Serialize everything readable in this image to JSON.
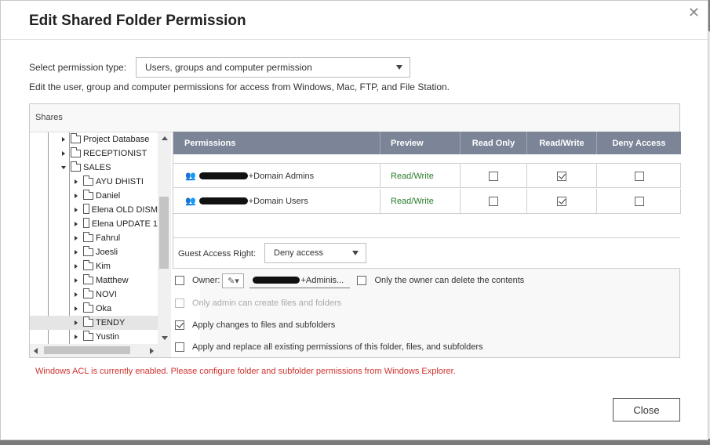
{
  "dialog": {
    "title": "Edit Shared Folder Permission",
    "close_icon": "close-icon"
  },
  "permission_type": {
    "label": "Select permission type:",
    "value": "Users, groups and computer permission"
  },
  "description": "Edit the user, group and computer permissions for access from Windows, Mac, FTP, and File Station.",
  "shares": {
    "label": "Shares",
    "items": [
      {
        "label": "Project Database",
        "expanded": false,
        "selected": false
      },
      {
        "label": "RECEPTIONIST",
        "expanded": false,
        "selected": false
      },
      {
        "label": "SALES",
        "expanded": true,
        "selected": false
      },
      {
        "label": "AYU DHISTI",
        "expanded": false,
        "selected": false
      },
      {
        "label": "Daniel",
        "expanded": false,
        "selected": false
      },
      {
        "label": "Elena OLD DISM",
        "expanded": false,
        "selected": false
      },
      {
        "label": "Elena UPDATE 1",
        "expanded": false,
        "selected": false
      },
      {
        "label": "Fahrul",
        "expanded": false,
        "selected": false
      },
      {
        "label": "Joesli",
        "expanded": false,
        "selected": false
      },
      {
        "label": "Kim",
        "expanded": false,
        "selected": false
      },
      {
        "label": "Matthew",
        "expanded": false,
        "selected": false
      },
      {
        "label": "NOVI",
        "expanded": false,
        "selected": false
      },
      {
        "label": "Oka",
        "expanded": false,
        "selected": false
      },
      {
        "label": "TENDY",
        "expanded": false,
        "selected": true
      },
      {
        "label": "Yustin",
        "expanded": false,
        "selected": false
      }
    ]
  },
  "permissions_table": {
    "columns": [
      "Permissions",
      "Preview",
      "Read Only",
      "Read/Write",
      "Deny Access"
    ],
    "rows": [
      {
        "name": "+Domain Admins",
        "preview": "Read/Write",
        "read_only": false,
        "read_write": true,
        "deny": false
      },
      {
        "name": "+Domain Users",
        "preview": "Read/Write",
        "read_only": false,
        "read_write": true,
        "deny": false
      }
    ]
  },
  "guest_access": {
    "label": "Guest Access Right:",
    "value": "Deny access"
  },
  "options": {
    "owner_label": "Owner:",
    "owner_value": "+Adminis...",
    "owner_only_delete": "Only the owner can delete the contents",
    "admin_only_create": "Only admin can create files and folders",
    "apply_changes": "Apply changes to files and subfolders",
    "apply_replace": "Apply and replace all existing permissions of this folder, files, and subfolders"
  },
  "acl_message": "Windows ACL is currently enabled. Please configure folder and subfolder permissions from Windows Explorer.",
  "buttons": {
    "close": "Close"
  },
  "colors": {
    "table_header": "#7c8597",
    "preview_text": "#2a7d2a",
    "warning_text": "#d0312d"
  }
}
